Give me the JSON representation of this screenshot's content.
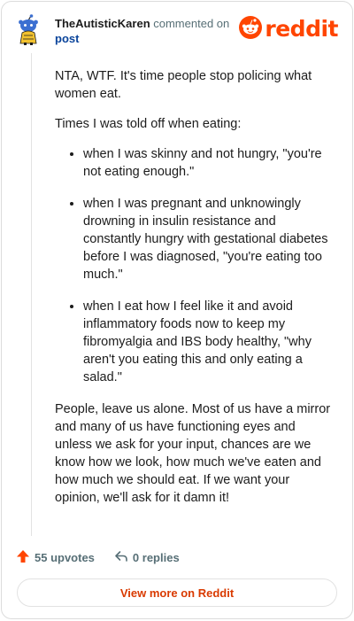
{
  "header": {
    "username": "TheAutisticKaren",
    "action_text": " commented on",
    "post_link": "post",
    "brand_name": "reddit"
  },
  "comment": {
    "paragraph_1": "NTA, WTF. It's time people stop policing what women eat.",
    "paragraph_2": "Times I was told off when eating:",
    "bullets": [
      "when I was skinny and not hungry, \"you're not eating enough.\"",
      "when I was pregnant and unknowingly drowning in insulin resistance and constantly hungry with gestational diabetes before I was diagnosed, \"you're eating too much.\"",
      "when I eat how I feel like it and avoid inflammatory foods now to keep my fibromyalgia and IBS body healthy, \"why aren't you eating this and only eating a salad.\""
    ],
    "paragraph_3": "People, leave us alone. Most of us have a mirror and many of us have functioning eyes and unless we ask for your input, chances are we know how we look, how much we've eaten and how much we should eat. If we want your opinion, we'll ask for it damn it!"
  },
  "actions": {
    "upvotes": "55 upvotes",
    "replies": "0 replies"
  },
  "footer": {
    "view_more": "View more on Reddit"
  },
  "colors": {
    "brand": "#ff4500",
    "link": "#0a449b",
    "muted": "#576f76",
    "cta": "#d93a00"
  },
  "icons": {
    "avatar": "snoo-avatar-icon",
    "brand": "reddit-logo-icon",
    "upvote": "upvote-arrow-icon",
    "reply": "reply-arrow-icon"
  }
}
